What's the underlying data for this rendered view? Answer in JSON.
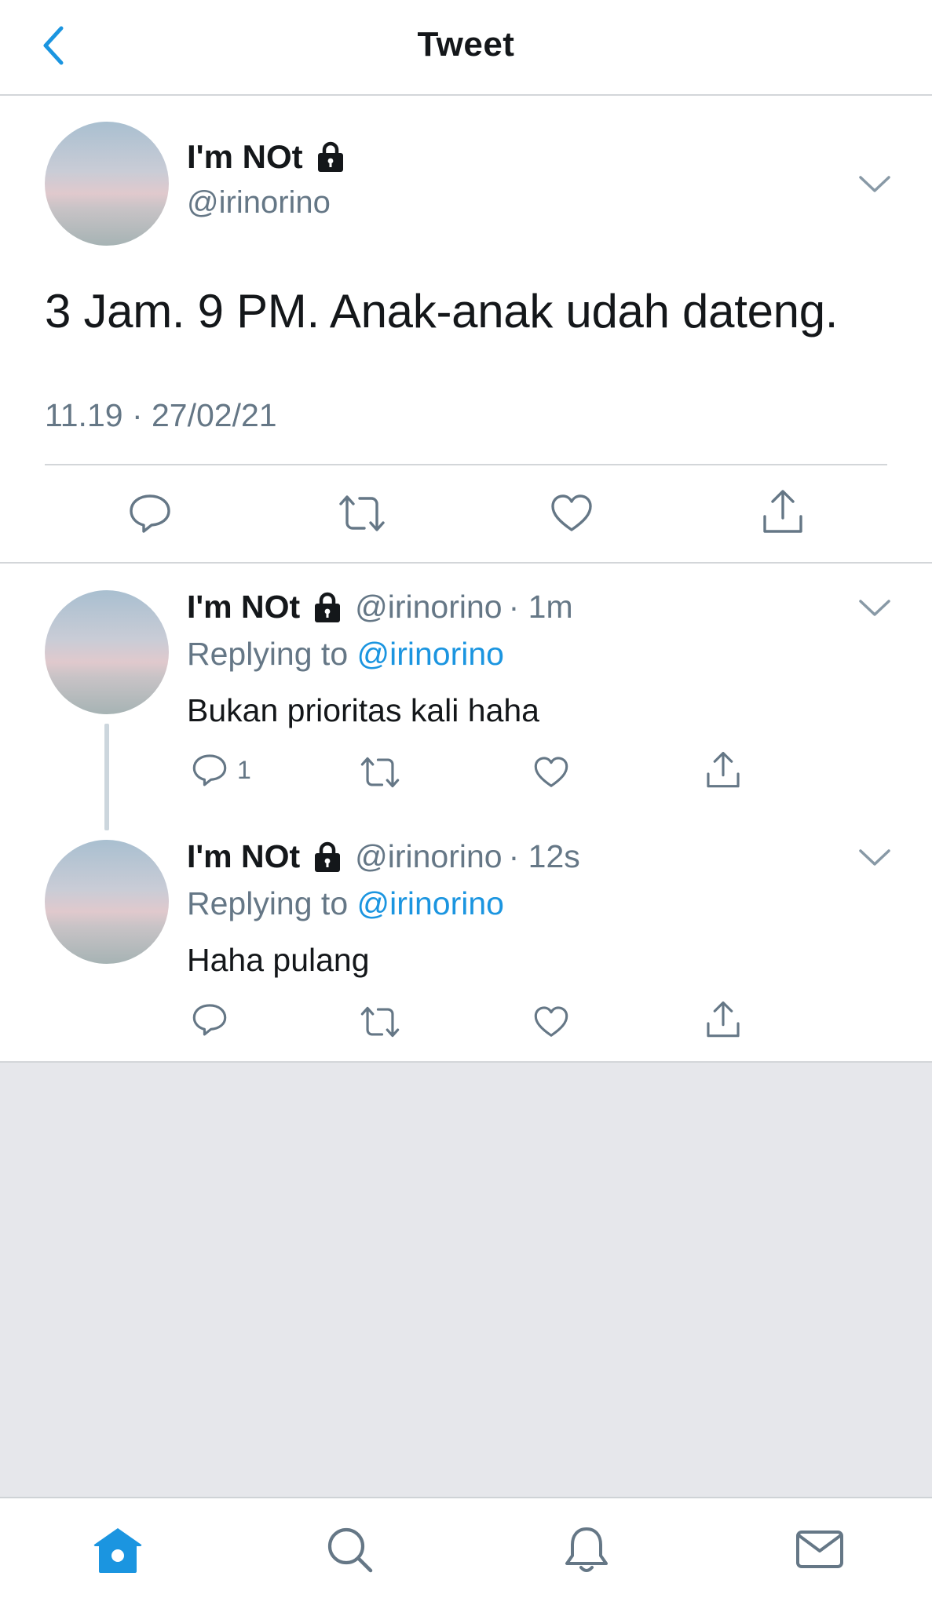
{
  "header": {
    "title": "Tweet"
  },
  "main_tweet": {
    "name": "I'm NOt",
    "handle": "@irinorino",
    "text": "3 Jam. 9 PM. Anak-anak udah dateng.",
    "timestamp": "11.19 · 27/02/21"
  },
  "replies": [
    {
      "name": "I'm NOt",
      "handle": "@irinorino",
      "time": "· 1m",
      "replying_prefix": "Replying to ",
      "replying_handle": "@irinorino",
      "text": "Bukan prioritas kali haha",
      "reply_count": "1"
    },
    {
      "name": "I'm NOt",
      "handle": "@irinorino",
      "time": "· 12s",
      "replying_prefix": "Replying to ",
      "replying_handle": "@irinorino",
      "text": "Haha pulang",
      "reply_count": ""
    }
  ],
  "icons": {
    "back": "chevron-left-icon",
    "lock": "lock-icon",
    "more": "chevron-down-icon",
    "actions": [
      "reply-icon",
      "retweet-icon",
      "like-icon",
      "share-icon"
    ],
    "tabs": [
      "home-icon",
      "search-icon",
      "notifications-icon",
      "messages-icon"
    ]
  },
  "colors": {
    "accent": "#1b95e0",
    "text": "#14171a",
    "muted": "#657786",
    "background_empty": "#e6e7eb"
  }
}
